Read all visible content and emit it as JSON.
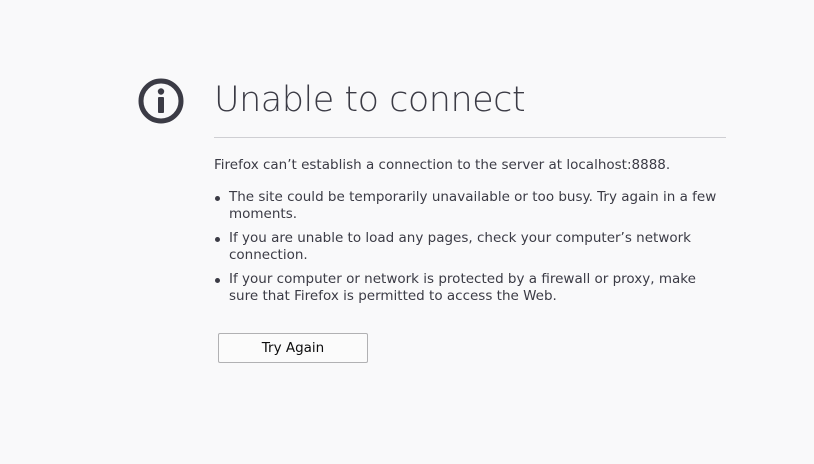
{
  "error": {
    "icon": "info-icon",
    "title": "Unable to connect",
    "intro": "Firefox can’t establish a connection to the server at localhost:8888.",
    "reasons": [
      "The site could be temporarily unavailable or too busy. Try again in a few moments.",
      "If you are unable to load any pages, check your computer’s network connection.",
      "If your computer or network is protected by a firewall or proxy, make sure that Firefox is permitted to access the Web."
    ],
    "button_label": "Try Again"
  },
  "colors": {
    "background": "#f9f9fa",
    "text": "#3b3b45",
    "icon": "#3b3b45",
    "divider": "#cfcfd3"
  }
}
